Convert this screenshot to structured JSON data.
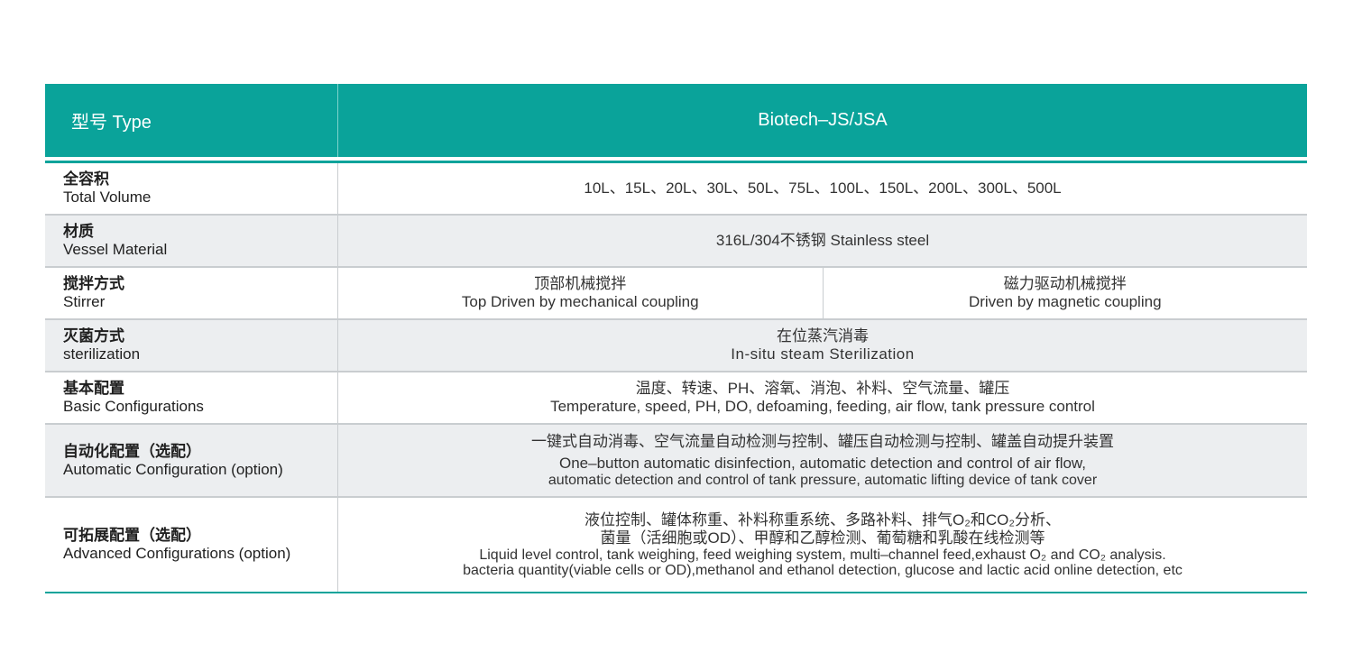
{
  "header": {
    "label": "型号 Type",
    "value": "Biotech–JS/JSA"
  },
  "rows": [
    {
      "label_zh": "全容积",
      "label_en": "Total Volume",
      "lines": [
        "10L、15L、20L、30L、50L、75L、100L、150L、200L、300L、500L"
      ]
    },
    {
      "label_zh": "材质",
      "label_en": "Vessel Material",
      "lines": [
        "316L/304不锈钢 Stainless steel"
      ]
    },
    {
      "label_zh": "搅拌方式",
      "label_en": "Stirrer",
      "left": [
        "顶部机械搅拌",
        "Top Driven by mechanical coupling"
      ],
      "right": [
        "磁力驱动机械搅拌",
        "Driven by magnetic coupling"
      ]
    },
    {
      "label_zh": "灭菌方式",
      "label_en": "sterilization",
      "lines": [
        "在位蒸汽消毒",
        "In-situ steam Sterilization"
      ]
    },
    {
      "label_zh": "基本配置",
      "label_en": "Basic Configurations",
      "lines": [
        "温度、转速、PH、溶氧、消泡、补料、空气流量、罐压",
        "Temperature, speed, PH, DO, defoaming, feeding, air flow, tank pressure control"
      ]
    },
    {
      "label_zh": "自动化配置（选配）",
      "label_en": "Automatic Configuration (option)",
      "lines": [
        "一键式自动消毒、空气流量自动检测与控制、罐压自动检测与控制、罐盖自动提升装置",
        "One–button automatic disinfection, automatic detection and control of air flow,",
        "automatic detection and control of tank pressure, automatic lifting device of tank cover"
      ]
    },
    {
      "label_zh": "可拓展配置（选配）",
      "label_en": "Advanced Configurations (option)",
      "lines": [
        "液位控制、罐体称重、补料称重系统、多路补料、排气O₂和CO₂分析、",
        "菌量（活细胞或OD）、甲醇和乙醇检测、葡萄糖和乳酸在线检测等",
        "Liquid level control, tank weighing, feed weighing system, multi–channel feed,exhaust O₂ and CO₂ analysis.",
        "bacteria quantity(viable cells or OD),methanol and ethanol detection, glucose and lactic acid online detection, etc"
      ]
    }
  ]
}
